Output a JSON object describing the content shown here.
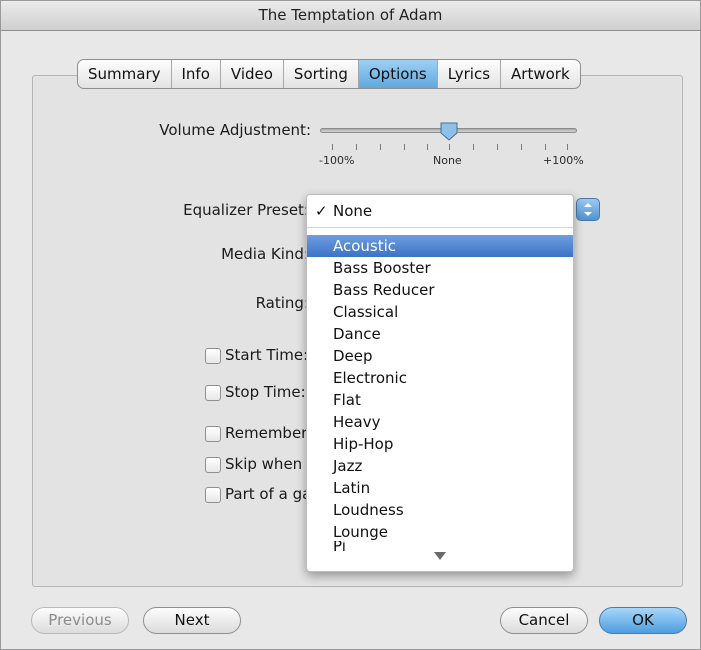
{
  "window": {
    "title": "The Temptation of Adam"
  },
  "tabs": [
    {
      "label": "Summary"
    },
    {
      "label": "Info"
    },
    {
      "label": "Video"
    },
    {
      "label": "Sorting"
    },
    {
      "label": "Options"
    },
    {
      "label": "Lyrics"
    },
    {
      "label": "Artwork"
    }
  ],
  "active_tab": "Options",
  "options": {
    "volume_label": "Volume Adjustment:",
    "volume_ticks": {
      "min": "-100%",
      "mid": "None",
      "max": "+100%"
    },
    "volume_value_percent": 0,
    "equalizer_label": "Equalizer Preset:",
    "media_kind_label": "Media Kind:",
    "rating_label": "Rating:",
    "start_time_label": "Start Time:",
    "stop_time_label": "Stop Time:",
    "remember_label": "Remember",
    "skip_label": "Skip when",
    "part_label": "Part of a ga"
  },
  "equalizer_menu": {
    "selected": "None",
    "highlighted": "Acoustic",
    "items": [
      "Acoustic",
      "Bass Booster",
      "Bass Reducer",
      "Classical",
      "Dance",
      "Deep",
      "Electronic",
      "Flat",
      "Heavy",
      "Hip-Hop",
      "Jazz",
      "Latin",
      "Loudness",
      "Lounge",
      "Pi"
    ]
  },
  "buttons": {
    "previous": "Previous",
    "next": "Next",
    "cancel": "Cancel",
    "ok": "OK"
  },
  "colors": {
    "accent": "#3c72c6",
    "default_button": "#4e9de0"
  }
}
